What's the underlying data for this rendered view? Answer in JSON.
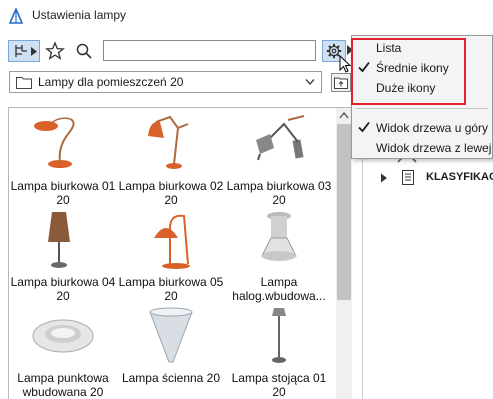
{
  "window": {
    "title": "Ustawienia lampy",
    "icon": "archicad-icon"
  },
  "toolbar": {
    "tree_icon": "tree-view-icon",
    "favorites_icon": "star-icon",
    "search_icon": "search-icon",
    "search_value": "",
    "settings_icon": "gear-icon"
  },
  "library": {
    "selected": "Lampy dla pomieszczeń 20",
    "folder_icon": "folder-icon",
    "up_icon": "folder-up-icon"
  },
  "items": [
    {
      "label_line1": "Lampa biurkowa 01",
      "label_line2": "20",
      "icon": "desk-lamp-01"
    },
    {
      "label_line1": "Lampa biurkowa 02",
      "label_line2": "20",
      "icon": "desk-lamp-02"
    },
    {
      "label_line1": "Lampa biurkowa 03",
      "label_line2": "20",
      "icon": "desk-lamp-03"
    },
    {
      "label_line1": "Lampa biurkowa 04",
      "label_line2": "20",
      "icon": "desk-lamp-04"
    },
    {
      "label_line1": "Lampa biurkowa 05",
      "label_line2": "20",
      "icon": "desk-lamp-05"
    },
    {
      "label_line1": "Lampa",
      "label_line2": "halog.wbudowa...",
      "icon": "halogen-lamp"
    },
    {
      "label_line1": "Lampa punktowa",
      "label_line2": "wbudowana 20",
      "icon": "recessed-spot"
    },
    {
      "label_line1": "Lampa ścienna 20",
      "label_line2": "",
      "icon": "wall-lamp"
    },
    {
      "label_line1": "Lampa stojąca 01",
      "label_line2": "20",
      "icon": "floor-lamp"
    }
  ],
  "menu": {
    "items": [
      {
        "label": "Lista",
        "checked": false
      },
      {
        "label": "Średnie ikony",
        "checked": true
      },
      {
        "label": "Duże ikony",
        "checked": false
      },
      {
        "label": "Widok drzewa u góry",
        "checked": true
      },
      {
        "label": "Widok drzewa z lewej",
        "checked": false
      }
    ]
  },
  "tree": {
    "node_label": "KLASYFIKACJ"
  },
  "colors": {
    "accent": "#2a6fc9",
    "highlight_border": "#e0232f",
    "lamp_orange": "#d9622b"
  }
}
